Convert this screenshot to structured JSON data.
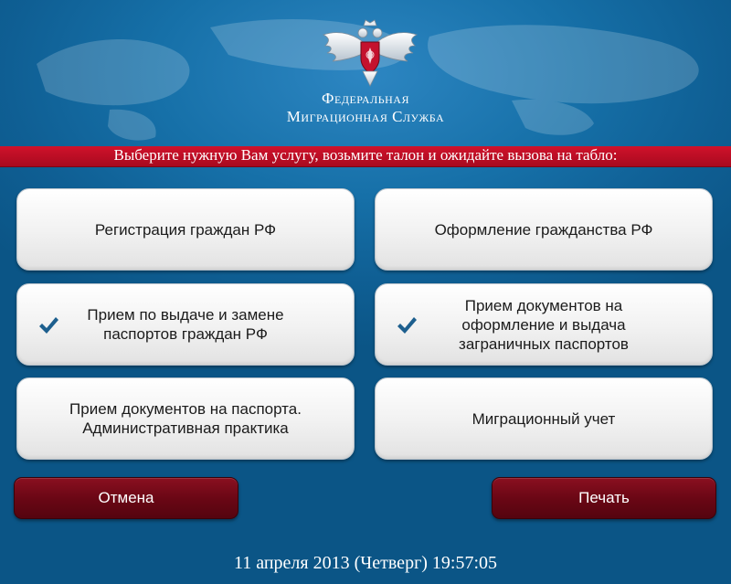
{
  "header": {
    "org_line1": "Федеральная",
    "org_line2": "Миграционная Служба",
    "instruction": "Выберите нужную Вам услугу, возьмите талон и ожидайте вызова на табло:"
  },
  "services": [
    {
      "label": "Регистрация граждан РФ",
      "checked": false
    },
    {
      "label": "Оформление гражданства РФ",
      "checked": false
    },
    {
      "label": "Прием по выдаче и замене\nпаспортов граждан РФ",
      "checked": true
    },
    {
      "label": "Прием документов на\nоформление и выдача\nзаграничных паспортов",
      "checked": true
    },
    {
      "label": "Прием документов на паспорта.\nАдминистративная практика",
      "checked": false
    },
    {
      "label": "Миграционный учет",
      "checked": false
    }
  ],
  "actions": {
    "cancel_label": "Отмена",
    "print_label": "Печать"
  },
  "footer": {
    "datetime": "11 апреля 2013 (Четверг) 19:57:05"
  },
  "colors": {
    "background": "#0f5f94",
    "band": "#c0102a",
    "action_button": "#6b0715",
    "check": "#1d5f8e"
  },
  "icons": {
    "emblem": "double-headed-eagle-emblem",
    "check": "checkmark-icon"
  }
}
